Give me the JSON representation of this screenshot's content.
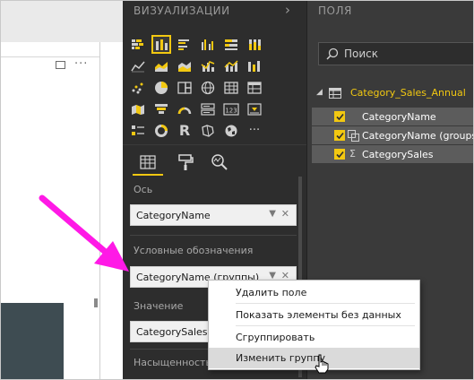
{
  "visualizations": {
    "title": "ВИЗУАЛИЗАЦИИ",
    "chevron": "›",
    "sections": {
      "axis": {
        "label": "Ось",
        "value": "CategoryName"
      },
      "legend": {
        "label": "Условные обозначения",
        "value": "CategoryName (группы)"
      },
      "values": {
        "label": "Значение",
        "value": "CategorySales"
      },
      "saturation": {
        "label": "Насыщенность"
      }
    },
    "icon_r_label": "R",
    "icon_123_label": "123",
    "icon_more_label": "···"
  },
  "fields": {
    "title": "ПОЛЯ",
    "search_placeholder": "Поиск",
    "table_name": "Category_Sales_Annual",
    "items": [
      {
        "name": "CategoryName",
        "checked": true,
        "grouped": false,
        "sigma": false
      },
      {
        "name": "CategoryName (groups)",
        "checked": true,
        "grouped": true,
        "sigma": false
      },
      {
        "name": "CategorySales",
        "checked": true,
        "grouped": false,
        "sigma": true
      }
    ]
  },
  "context_menu": {
    "items": [
      {
        "label": "Удалить поле"
      },
      {
        "label": "Показать элементы без данных"
      },
      {
        "label": "Сгруппировать"
      },
      {
        "label": "Изменить группу"
      }
    ]
  },
  "colors": {
    "accent": "#f2c811",
    "annotation_arrow": "#ff19e6",
    "pane_dark": "#2d2d2d",
    "fields_pane": "#3a3a3a"
  },
  "canvas": {
    "more_label": "···"
  }
}
